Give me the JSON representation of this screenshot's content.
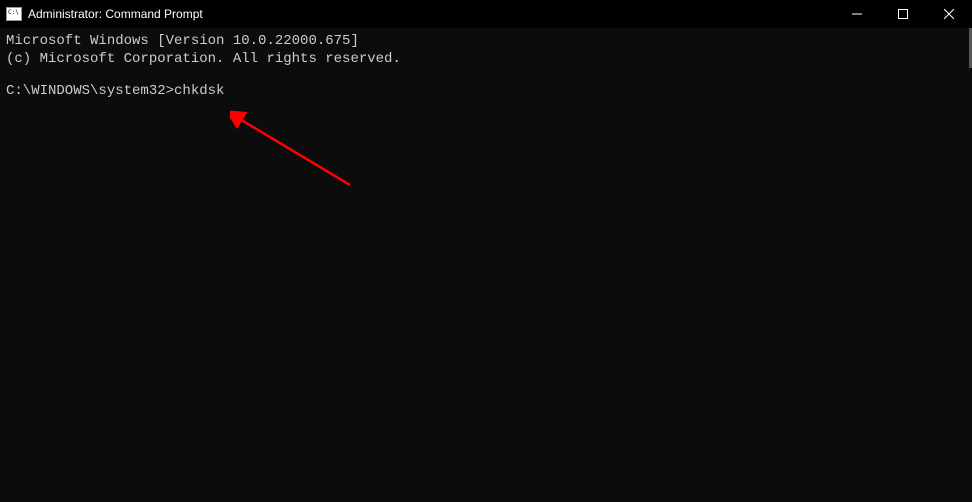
{
  "window": {
    "title": "Administrator: Command Prompt"
  },
  "terminal": {
    "line1": "Microsoft Windows [Version 10.0.22000.675]",
    "line2": "(c) Microsoft Corporation. All rights reserved.",
    "prompt": "C:\\WINDOWS\\system32>",
    "command": "chkdsk"
  }
}
